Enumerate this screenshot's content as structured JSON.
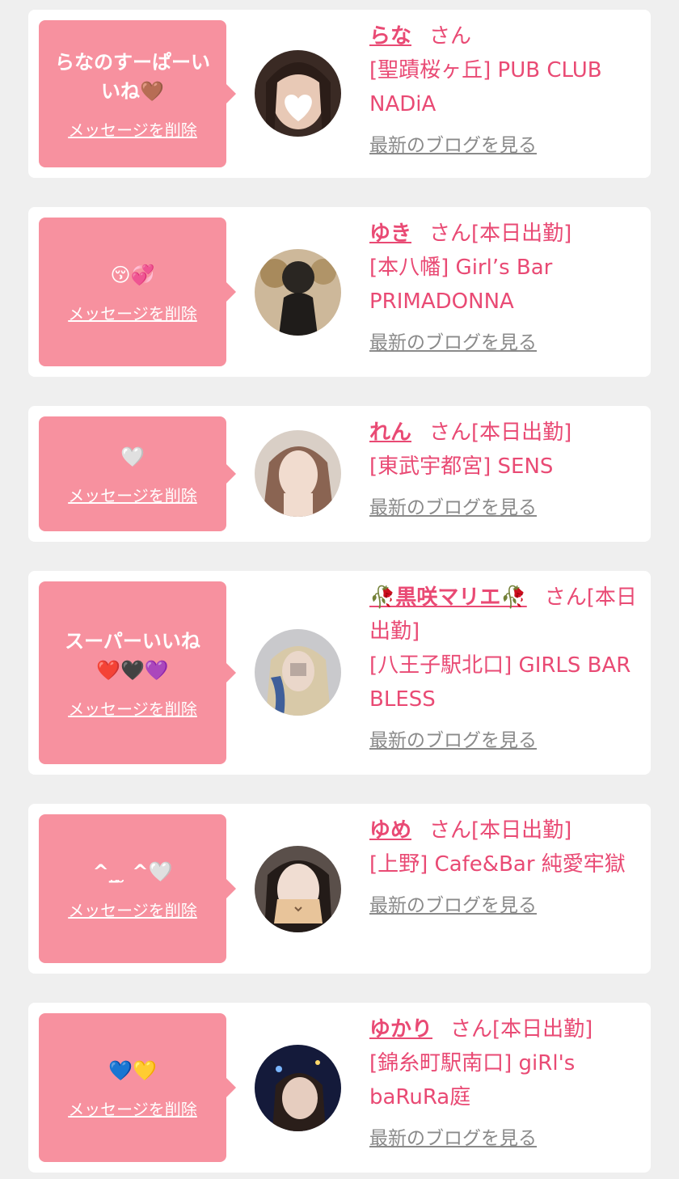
{
  "cards": [
    {
      "message": "らなのすーぱーいいね🤎",
      "delete_label": "メッセージを削除",
      "name": "らな",
      "suffix": "さん",
      "shop": "[聖蹟桜ヶ丘] PUB CLUB NADiA",
      "blog_label": "最新のブログを見る",
      "avatar": "avatar-photo-rana"
    },
    {
      "message": "😚💞",
      "delete_label": "メッセージを削除",
      "name": "ゆき",
      "suffix": "さん[本日出勤]",
      "shop": "[本八幡] Girl’s Bar PRIMADONNA",
      "blog_label": "最新のブログを見る",
      "avatar": "avatar-photo-yuki"
    },
    {
      "message": "🤍",
      "delete_label": "メッセージを削除",
      "name": "れん",
      "suffix": "さん[本日出勤]",
      "shop": "[東武宇都宮] SENS",
      "blog_label": "最新のブログを見る",
      "avatar": "avatar-photo-ren"
    },
    {
      "message": "スーパーいいね\n❤️🖤💜",
      "delete_label": "メッセージを削除",
      "name": "🥀黒咲マリエ🥀",
      "suffix": "さん[本日出勤]",
      "shop": "[八王子駅北口] GIRLS BAR BLESS",
      "blog_label": "最新のブログを見る",
      "avatar": "avatar-photo-marie"
    },
    {
      "message": "^_̮ ̮ ^🤍",
      "delete_label": "メッセージを削除",
      "name": "ゆめ",
      "suffix": "さん[本日出勤]",
      "shop": "[上野] Cafe&Bar 純愛牢獄",
      "blog_label": "最新のブログを見る",
      "avatar": "avatar-photo-yume"
    },
    {
      "message": "💙💛",
      "delete_label": "メッセージを削除",
      "name": "ゆかり",
      "suffix": "さん[本日出勤]",
      "shop": "[錦糸町駅南口] giRl's baRuRa庭",
      "blog_label": "最新のブログを見る",
      "avatar": "avatar-photo-yukari"
    }
  ],
  "colors": {
    "accent": "#e94a74",
    "bubble": "#f7919f",
    "background": "#efefef",
    "link_gray": "#8a8a8a"
  }
}
